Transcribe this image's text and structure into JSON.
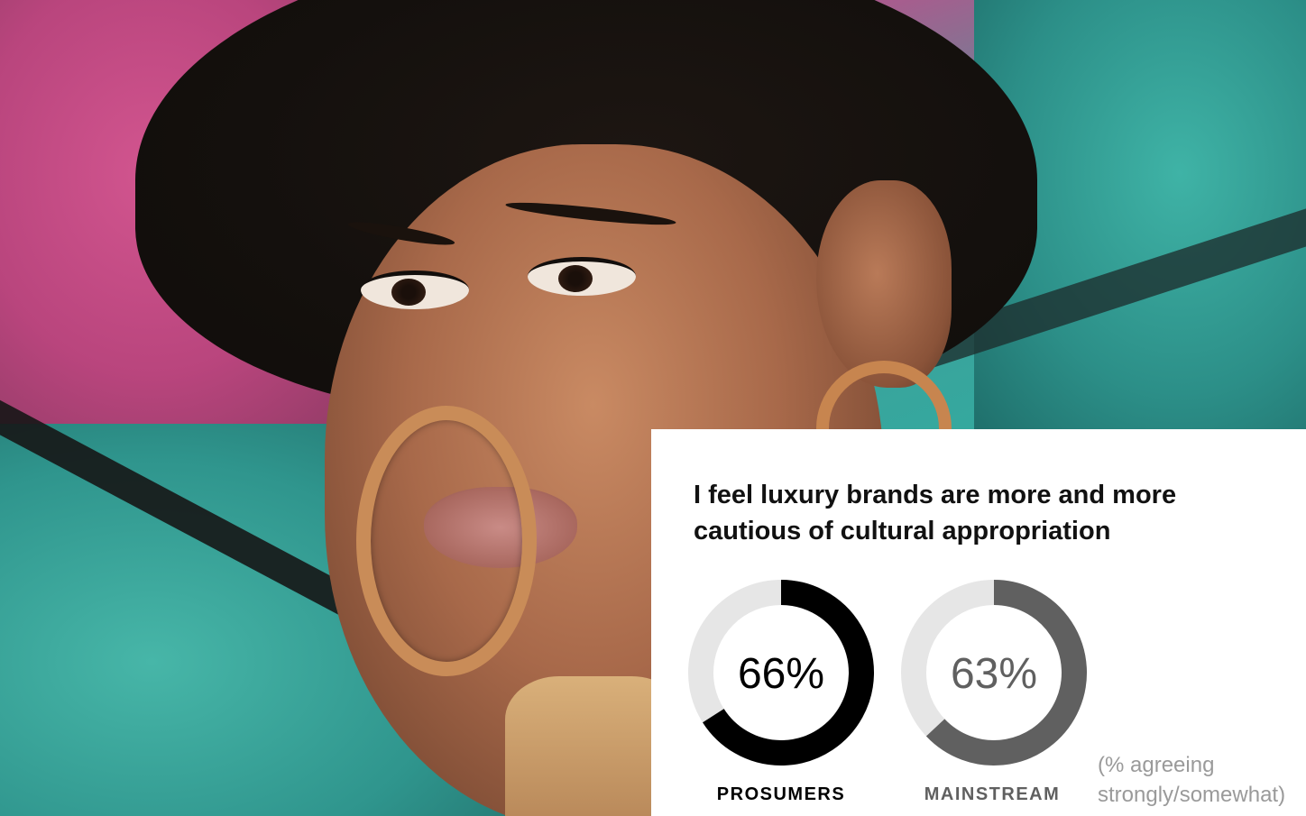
{
  "chart_data": {
    "type": "pie",
    "title": "I feel luxury brands are more and more cautious of cultural appropriation",
    "categories": [
      "PROSUMERS",
      "MAINSTREAM"
    ],
    "values": [
      66,
      63
    ],
    "value_labels": [
      "66%",
      "63%"
    ],
    "unit": "%",
    "note": "(% agreeing strongly/somewhat)",
    "colors": {
      "prosumers": "#000000",
      "mainstream": "#606060",
      "track": "#e6e6e6"
    }
  }
}
